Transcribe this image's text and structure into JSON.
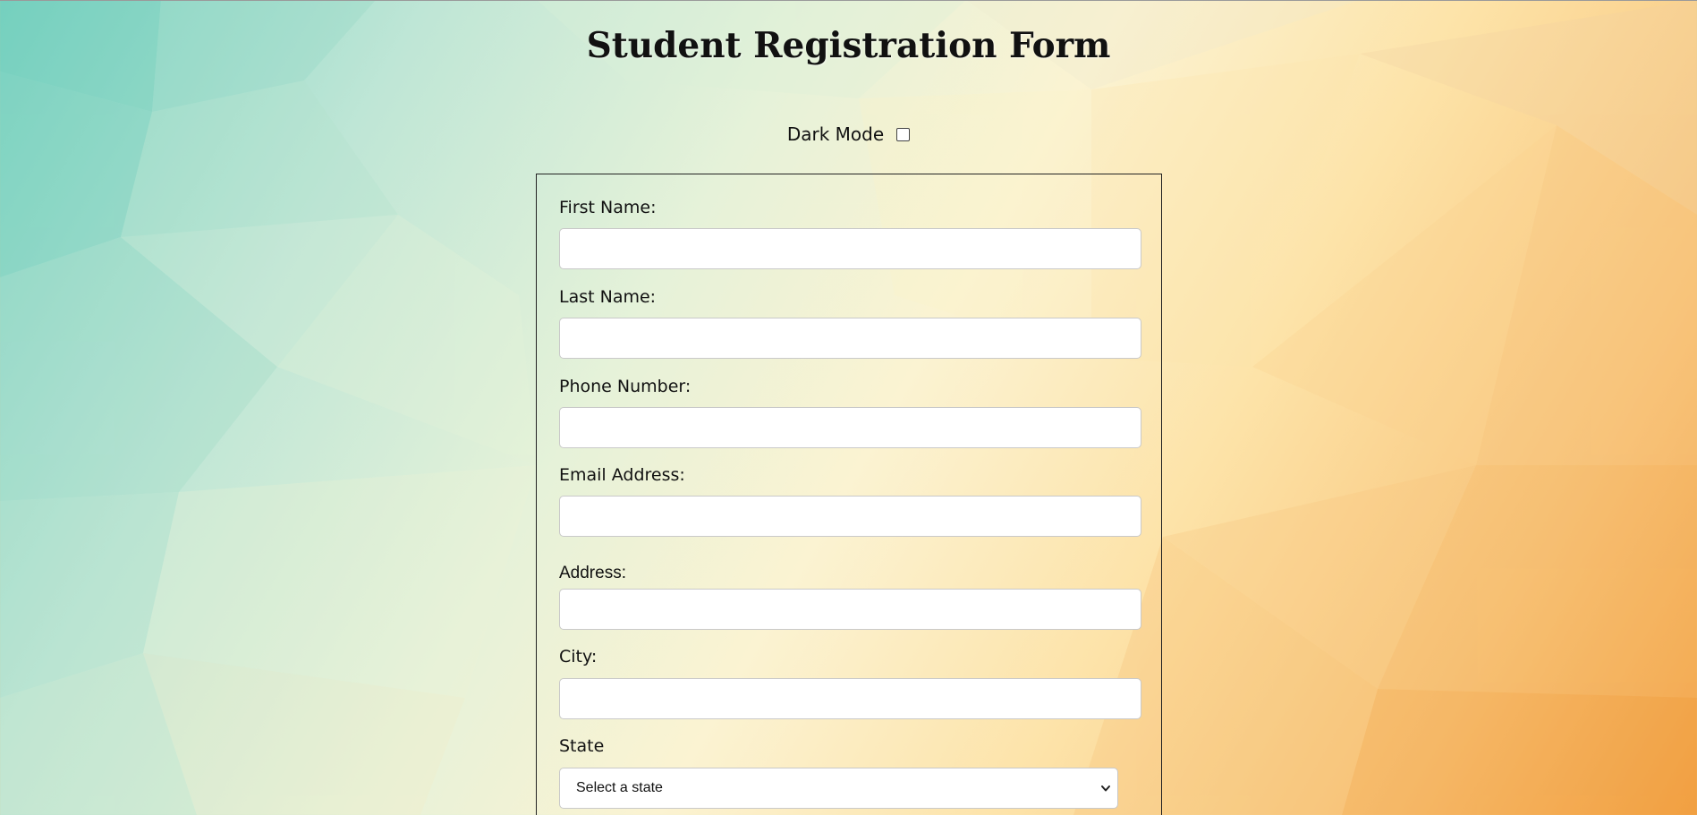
{
  "page": {
    "title": "Student Registration Form"
  },
  "dark_mode": {
    "label": "Dark Mode",
    "checked": false
  },
  "form": {
    "fields": [
      {
        "label": "First Name:",
        "value": "",
        "placeholder": ""
      },
      {
        "label": "Last Name:",
        "value": "",
        "placeholder": ""
      },
      {
        "label": "Phone Number:",
        "value": "",
        "placeholder": ""
      },
      {
        "label": "Email Address:",
        "value": "",
        "placeholder": ""
      },
      {
        "label": "Address:",
        "value": "",
        "placeholder": ""
      },
      {
        "label": "City:",
        "value": "",
        "placeholder": ""
      }
    ],
    "state": {
      "label": "State",
      "selected": "Select a state"
    }
  },
  "colors": {
    "background_teal": "#7fd4c4",
    "background_cream": "#fbf3d2",
    "background_orange": "#f2a246",
    "card_border": "#222222",
    "input_border": "#c9c9c9"
  },
  "icons": {
    "state_select": "chevron-down-icon",
    "dark_mode": "checkbox-icon"
  }
}
